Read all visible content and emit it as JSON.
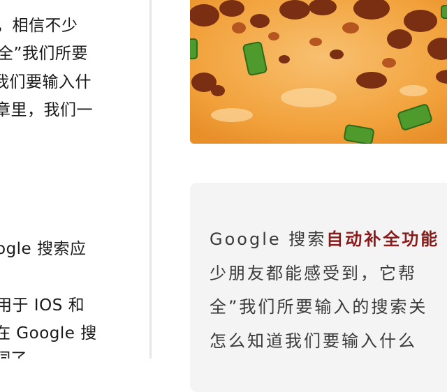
{
  "left_article": {
    "lines": [
      "，相信不少",
      "全”我们所要",
      "我们要输入什",
      "章里，我们一",
      "ogle 搜索应",
      "用于 IOS 和",
      "在 Google 搜",
      "词了。"
    ]
  },
  "card": {
    "line1_prefix": "Google 搜索",
    "line1_highlight": "自动补全功能",
    "line2": "少朋友都能感受到，它帮",
    "line3": "全”我们所要输入的搜索关",
    "line4": "怎么知道我们要输入什么"
  },
  "colors": {
    "highlight": "#8b1a1a",
    "card_background": "#f4f4f4",
    "divider": "#e6e6e6"
  }
}
